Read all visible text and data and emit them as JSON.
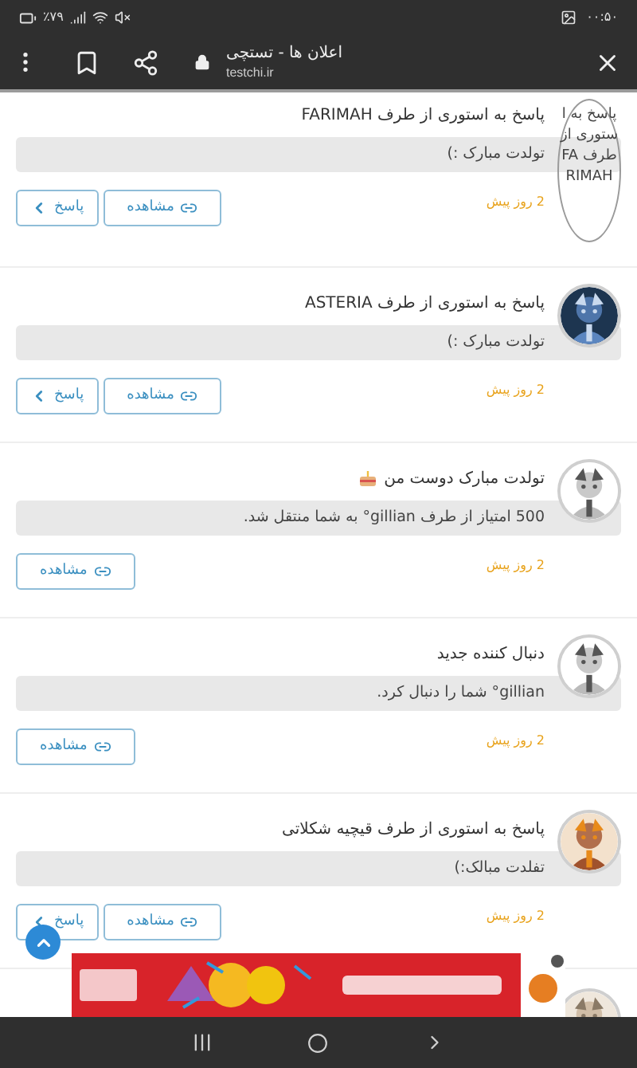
{
  "status_bar": {
    "battery": "٪۷۹",
    "time": "۰۰:۵۰"
  },
  "browser_bar": {
    "title": "اعلان ها - تستچی",
    "url": "testchi.ir"
  },
  "notifications": [
    {
      "title": "پاسخ به استوری از طرف FARIMAH",
      "message": "تولدت مبارک :)",
      "time": "2 روز پیش",
      "avatar": {
        "kind": "broken",
        "alt": "پاسخ به استوری از طرف FARIMAH"
      },
      "buttons": [
        {
          "kind": "view",
          "label": "مشاهده"
        },
        {
          "kind": "reply",
          "label": "پاسخ"
        }
      ]
    },
    {
      "title": "پاسخ به استوری از طرف ASTERIA",
      "message": "تولدت مبارک :)",
      "time": "2 روز پیش",
      "avatar": {
        "kind": "picture"
      },
      "buttons": [
        {
          "kind": "view",
          "label": "مشاهده"
        },
        {
          "kind": "reply",
          "label": "پاسخ"
        }
      ]
    },
    {
      "title": "تولدت مبارک دوست من",
      "title_icon": true,
      "message": "500 امتیاز از طرف gillian° به شما منتقل شد.",
      "time": "2 روز پیش",
      "avatar": {
        "kind": "picture"
      },
      "buttons": [
        {
          "kind": "view",
          "label": "مشاهده"
        }
      ]
    },
    {
      "title": "دنبال کننده جدید",
      "message": "gillian° شما را دنبال کرد.",
      "time": "2 روز پیش",
      "avatar": {
        "kind": "picture"
      },
      "buttons": [
        {
          "kind": "view",
          "label": "مشاهده"
        }
      ]
    },
    {
      "title": "پاسخ به استوری از طرف قیچیه شکلاتی",
      "message": "تفلدت مبالک:)",
      "time": "2 روز پیش",
      "avatar": {
        "kind": "picture"
      },
      "buttons": [
        {
          "kind": "view",
          "label": "مشاهده"
        },
        {
          "kind": "reply",
          "label": "پاسخ"
        }
      ]
    }
  ],
  "next_avatar": {
    "kind": "picture"
  },
  "ad_banner": {
    "kind": "picture"
  }
}
